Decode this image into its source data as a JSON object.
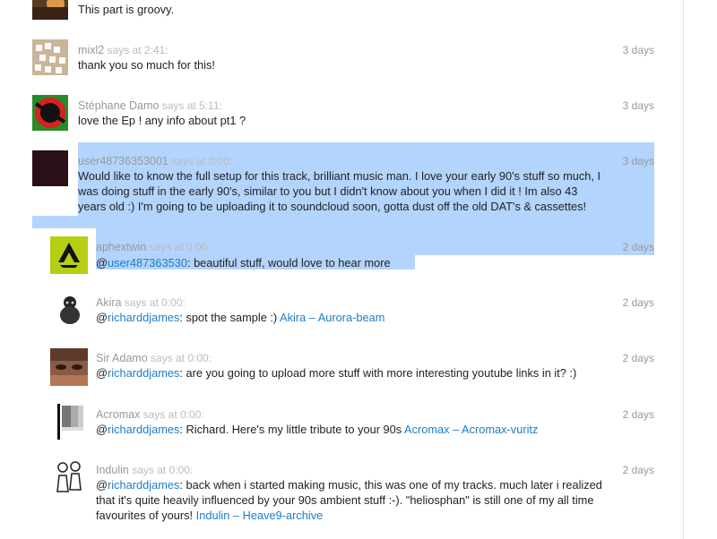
{
  "comments": [
    {
      "user": "",
      "says": "",
      "ago": "",
      "text": "This part is groovy."
    },
    {
      "user": "mixl2",
      "says": "says at 2:41:",
      "ago": "3 days",
      "text": "thank you so much for this!"
    },
    {
      "user": "Stéphane Damo",
      "says": "says at 5:11:",
      "ago": "3 days",
      "text": "love the Ep ! any info about pt1 ?"
    },
    {
      "user": "user48736353001",
      "says": "says at 0:00:",
      "ago": "3 days",
      "lines": [
        "Would like to know the full setup for this track, brilliant music man. I love your early 90's stuff so much, I",
        "was doing stuff in the early 90's, similar to you but I didn't know about you when I did it ! Im also 43",
        "years old :) I'm going to be uploading it to soundcloud soon, gotta dust off the old DAT's & cassettes!"
      ]
    },
    {
      "user": "aphextwin",
      "says": "says at 0:00:",
      "ago": "2 days",
      "prefix": "@",
      "mention": "user487363530",
      "text": ": beautiful stuff, would love to hear more"
    },
    {
      "user": "Akira",
      "says": "says at 0:00:",
      "ago": "2 days",
      "prefix": "@",
      "mention": "richarddjames",
      "text": ": spot the sample :) ",
      "link": "Akira – Aurora-beam"
    },
    {
      "user": "Sir Adamo",
      "says": "says at 0:00:",
      "ago": "2 days",
      "prefix": "@",
      "mention": "richarddjames",
      "text": ": are you going to upload more stuff with more interesting youtube links in it? :)"
    },
    {
      "user": "Acromax",
      "says": "says at 0:00:",
      "ago": "2 days",
      "prefix": "@",
      "mention": "richarddjames",
      "text": ": Richard. Here's my little tribute to your 90s ",
      "link": "Acromax – Acromax-vuritz"
    },
    {
      "user": "Indulin",
      "says": "says at 0:00:",
      "ago": "2 days",
      "prefix": "@",
      "mention": "richarddjames",
      "line1": ": back when i started making music, this was one of my tracks. much later i realized",
      "line2": "that it's quite heavily influenced by your 90s ambient stuff :-). \"heliosphan\" is still one of my all time",
      "line3": "favourites of yours! ",
      "link": "Indulin – Heave9-archive"
    }
  ],
  "colors": {
    "selection": "#b3d4fc",
    "link": "#1e7dc8",
    "meta": "#999999"
  },
  "icons": [
    "avatar-photo",
    "avatar-jigsaw",
    "avatar-red-circle",
    "avatar-dark",
    "aphex-logo-icon",
    "monkey-figure-icon",
    "face-photo",
    "grayscale-bars",
    "sketch-figures-icon"
  ]
}
